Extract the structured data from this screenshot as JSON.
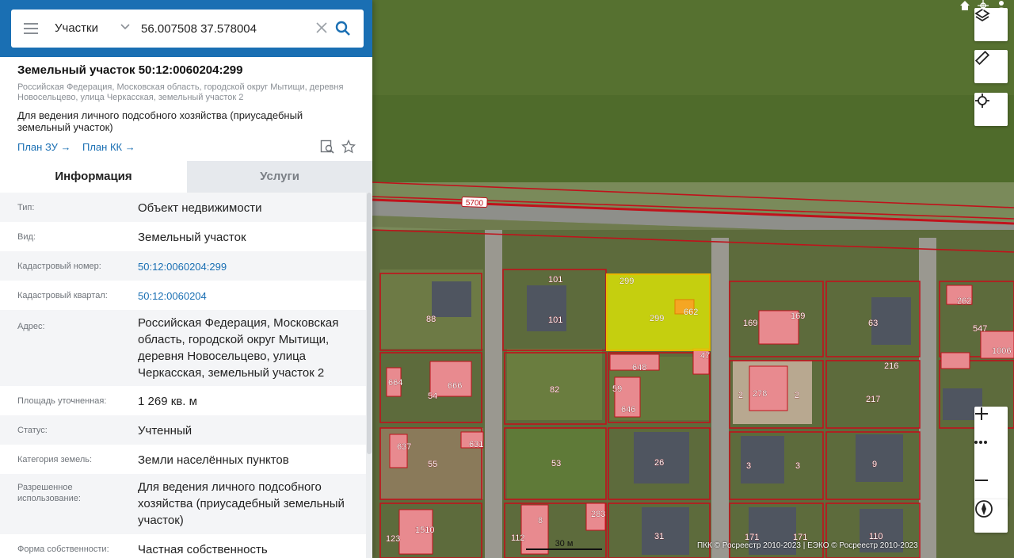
{
  "search": {
    "category": "Участки",
    "query": "56.007508 37.578004"
  },
  "object": {
    "title": "Земельный участок 50:12:0060204:299",
    "address": "Российская Федерация, Московская область, городской округ Мытищи, деревня Новосельцево, улица Черкасская, земельный участок 2",
    "purpose": "Для ведения личного подсобного хозяйства (приусадебный земельный участок)",
    "plan_zu": "План ЗУ",
    "plan_kk": "План КК"
  },
  "tabs": {
    "info": "Информация",
    "services": "Услуги"
  },
  "info": [
    {
      "label": "Тип:",
      "value": "Объект недвижимости"
    },
    {
      "label": "Вид:",
      "value": "Земельный участок"
    },
    {
      "label": "Кадастровый номер:",
      "value": "50:12:0060204:299"
    },
    {
      "label": "Кадастровый квартал:",
      "value": "50:12:0060204"
    },
    {
      "label": "Адрес:",
      "value": "Российская Федерация, Московская область, городской округ Мытищи, деревня Новосельцево, улица Черкасская, земельный участок 2"
    },
    {
      "label": "Площадь уточненная:",
      "value": "1 269 кв. м"
    },
    {
      "label": "Статус:",
      "value": "Учтенный"
    },
    {
      "label": "Категория земель:",
      "value": "Земли населённых пунктов"
    },
    {
      "label": "Разрешенное использование:",
      "value": "Для ведения личного подсобного хозяйства (приусадебный земельный участок)"
    },
    {
      "label": "Форма собственности:",
      "value": "Частная собственность"
    }
  ],
  "map": {
    "road_label": "5700",
    "selected_parcel_labels": [
      "299",
      "299",
      "662"
    ],
    "parcel_labels": [
      "101",
      "101",
      "88",
      "169",
      "169",
      "63",
      "262",
      "547",
      "1006",
      "216",
      "217",
      "648",
      "59",
      "646",
      "82",
      "54",
      "666",
      "664",
      "47",
      "2",
      "278",
      "2",
      "637",
      "631",
      "55",
      "53",
      "26",
      "3",
      "3",
      "9",
      "123",
      "1510",
      "112",
      "8",
      "283",
      "31",
      "171",
      "171",
      "110"
    ],
    "scale": "30 м",
    "copyright": "ПКК © Росреестр 2010-2023 | ЕЭКО © Росреестр 2010-2023",
    "colors": {
      "parcel_border": "#c0121b",
      "selected_parcel": "#e8f000",
      "building": "#e88a8f",
      "panel_header": "#1a6fb3",
      "link": "#1a6fb3"
    }
  }
}
